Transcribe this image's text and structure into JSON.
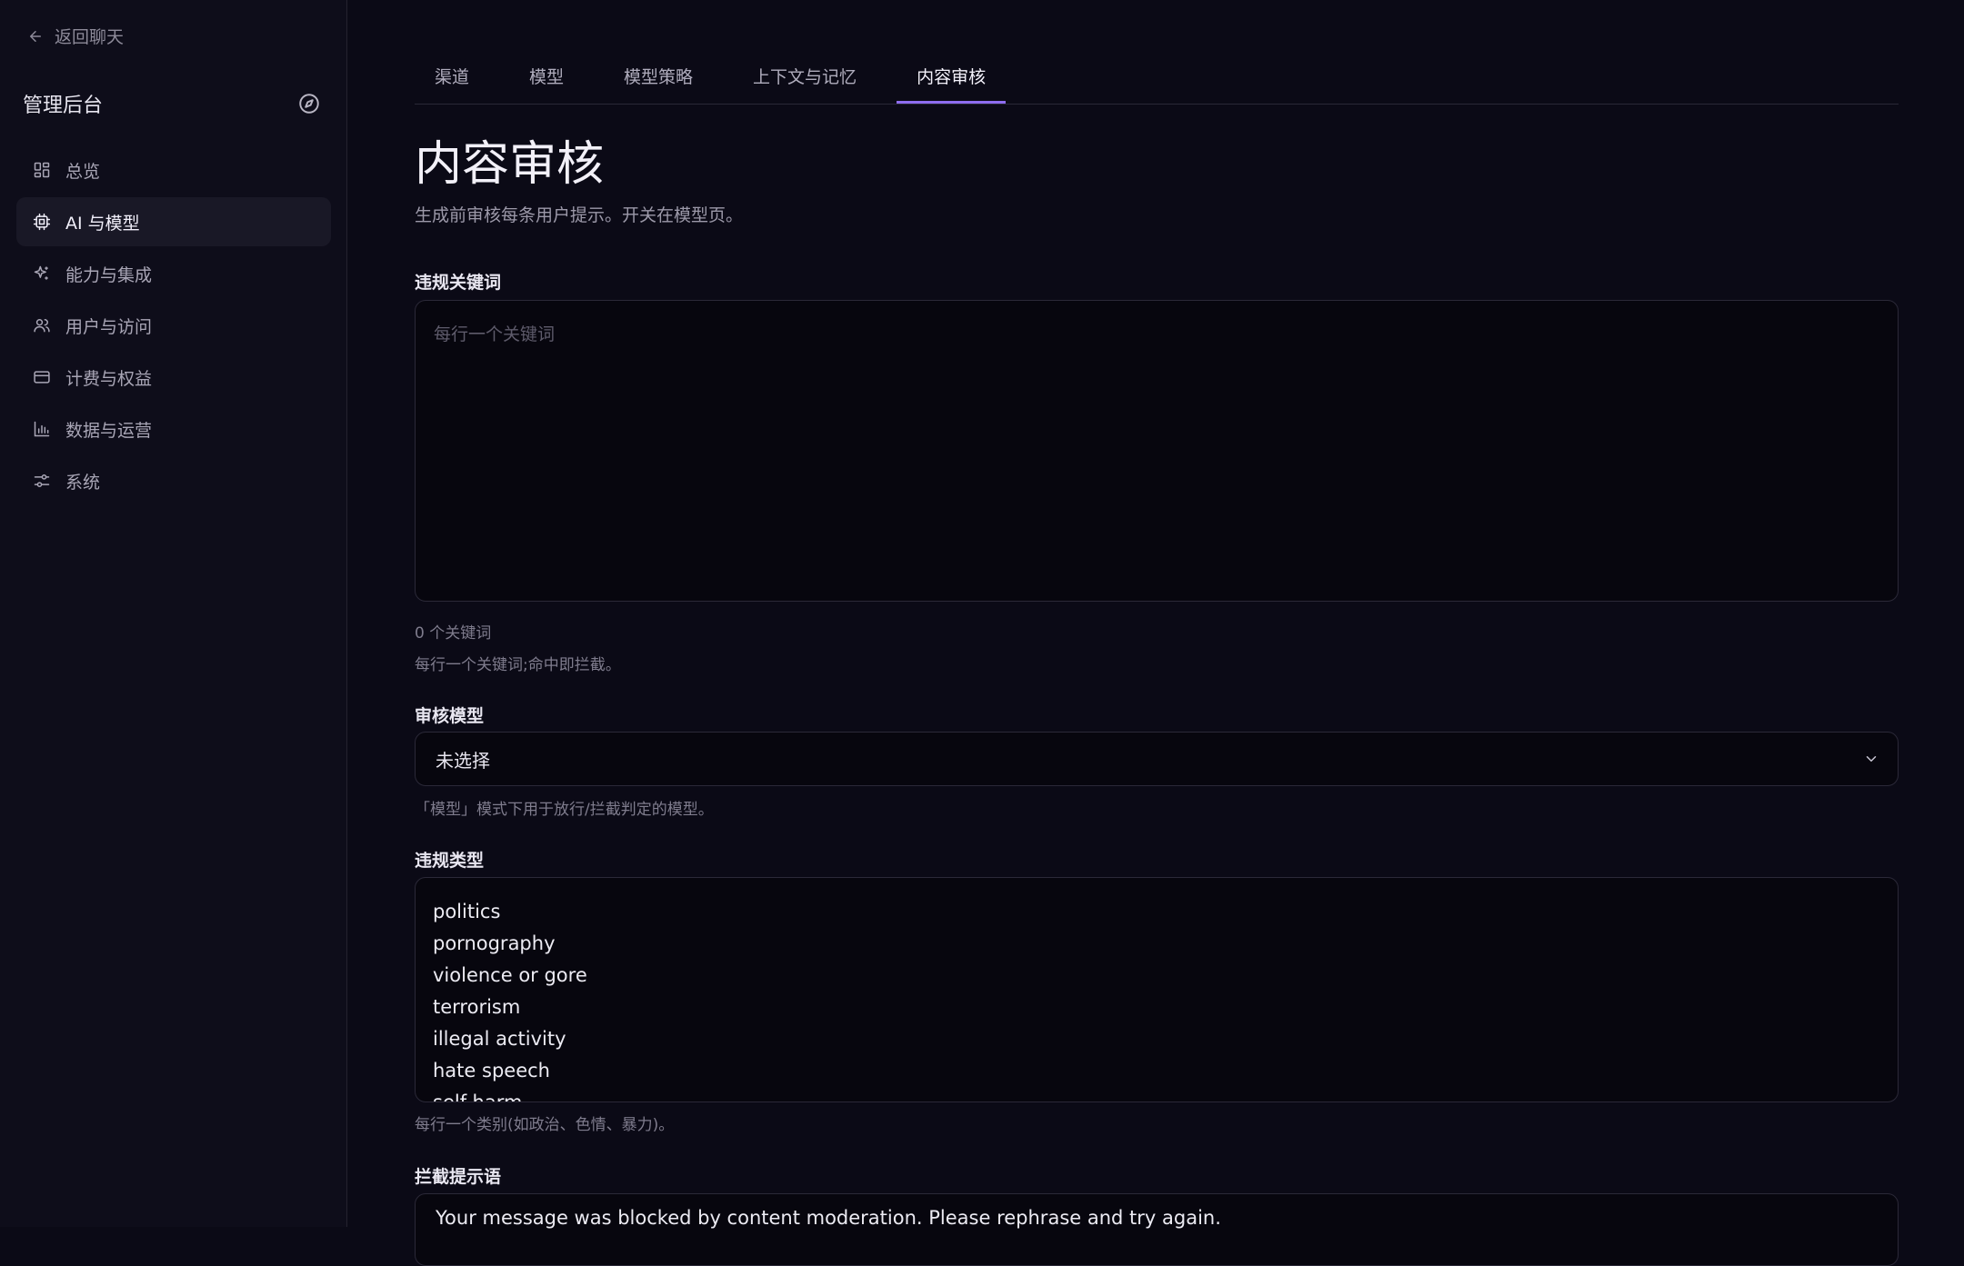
{
  "sidebar": {
    "back_label": "返回聊天",
    "title": "管理后台",
    "items": [
      {
        "label": "总览",
        "icon": "dashboard-icon",
        "active": false
      },
      {
        "label": "AI 与模型",
        "icon": "cpu-icon",
        "active": true
      },
      {
        "label": "能力与集成",
        "icon": "sparkle-icon",
        "active": false
      },
      {
        "label": "用户与访问",
        "icon": "users-icon",
        "active": false
      },
      {
        "label": "计费与权益",
        "icon": "credit-card-icon",
        "active": false
      },
      {
        "label": "数据与运营",
        "icon": "bar-chart-icon",
        "active": false
      },
      {
        "label": "系统",
        "icon": "sliders-icon",
        "active": false
      }
    ]
  },
  "tabs": [
    {
      "label": "渠道",
      "active": false
    },
    {
      "label": "模型",
      "active": false
    },
    {
      "label": "模型策略",
      "active": false
    },
    {
      "label": "上下文与记忆",
      "active": false
    },
    {
      "label": "内容审核",
      "active": true
    }
  ],
  "page": {
    "title": "内容审核",
    "subtitle": "生成前审核每条用户提示。开关在模型页。"
  },
  "keywords": {
    "label": "违规关键词",
    "placeholder": "每行一个关键词",
    "count": "0 个关键词",
    "hint": "每行一个关键词;命中即拦截。"
  },
  "model": {
    "label": "审核模型",
    "selected": "未选择",
    "hint": "「模型」模式下用于放行/拦截判定的模型。"
  },
  "types": {
    "label": "违规类型",
    "items": [
      "politics",
      "pornography",
      "violence or gore",
      "terrorism",
      "illegal activity",
      "hate speech",
      "self-harm"
    ],
    "hint": "每行一个类别(如政治、色情、暴力)。"
  },
  "block_message": {
    "label": "拦截提示语",
    "value": "Your message was blocked by content moderation. Please rephrase and try again."
  },
  "colors": {
    "accent": "#8e6df0",
    "background": "#0b0a16",
    "sidebar": "#0e0d1a"
  }
}
